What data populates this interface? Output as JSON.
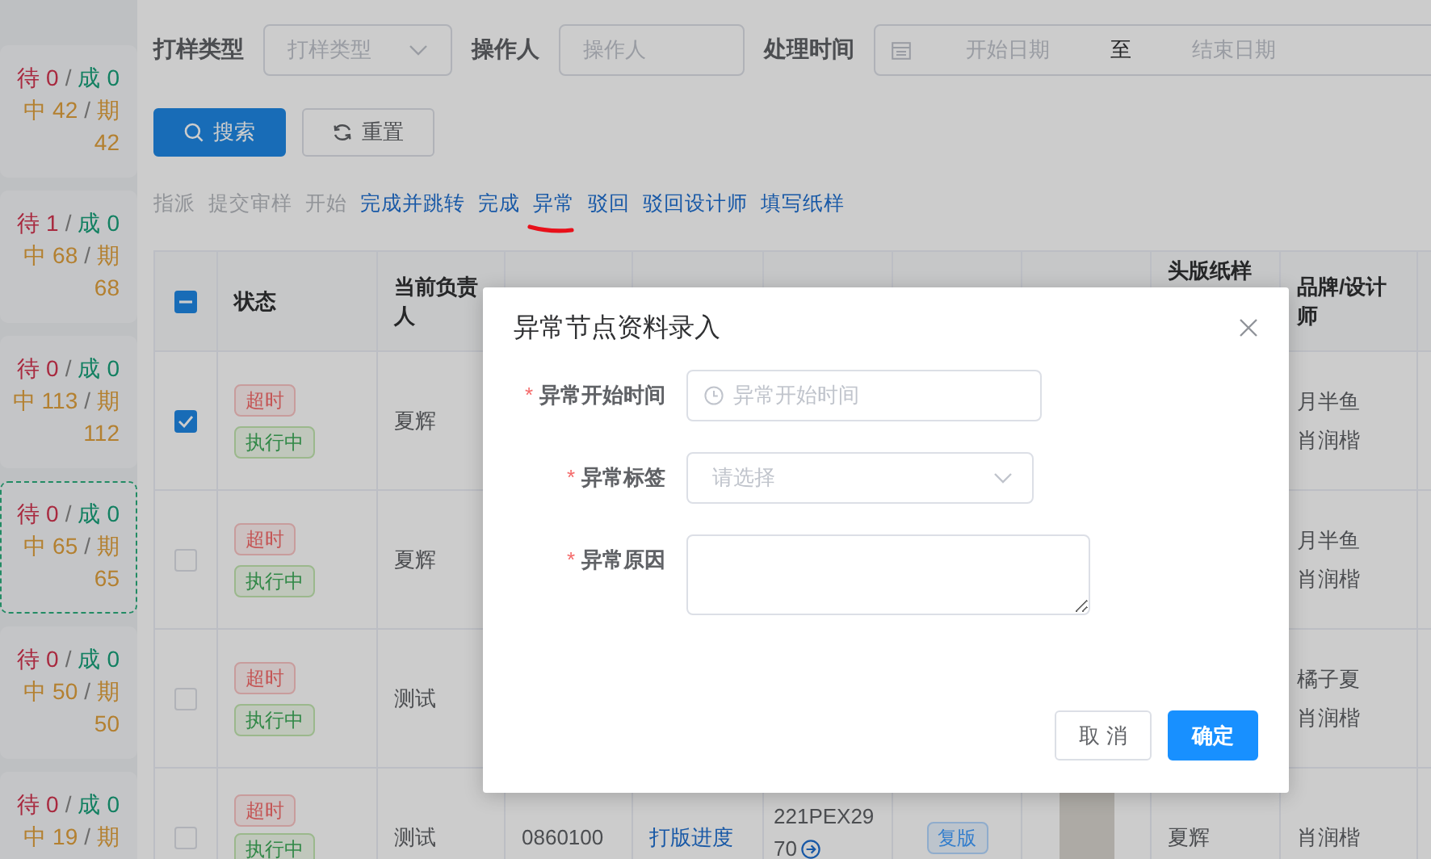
{
  "side_panel": {
    "separator": "/",
    "cards": [
      {
        "selected": false,
        "stats": [
          {
            "kind": "pending",
            "label": "待",
            "value": "0"
          },
          {
            "kind": "done",
            "label": "成",
            "value": "0"
          },
          {
            "kind": "active",
            "label": "中",
            "value": "42"
          },
          {
            "kind": "due",
            "label": "期",
            "value": "42"
          }
        ]
      },
      {
        "selected": false,
        "stats": [
          {
            "kind": "pending",
            "label": "待",
            "value": "1"
          },
          {
            "kind": "done",
            "label": "成",
            "value": "0"
          },
          {
            "kind": "active",
            "label": "中",
            "value": "68"
          },
          {
            "kind": "due",
            "label": "期",
            "value": "68"
          }
        ]
      },
      {
        "selected": false,
        "stats": [
          {
            "kind": "pending",
            "label": "待",
            "value": "0"
          },
          {
            "kind": "done",
            "label": "成",
            "value": "0"
          },
          {
            "kind": "active",
            "label": "中",
            "value": "113"
          },
          {
            "kind": "due",
            "label": "期",
            "value": "112"
          }
        ]
      },
      {
        "selected": true,
        "stats": [
          {
            "kind": "pending",
            "label": "待",
            "value": "0"
          },
          {
            "kind": "done",
            "label": "成",
            "value": "0"
          },
          {
            "kind": "active",
            "label": "中",
            "value": "65"
          },
          {
            "kind": "due",
            "label": "期",
            "value": "65"
          }
        ]
      },
      {
        "selected": false,
        "stats": [
          {
            "kind": "pending",
            "label": "待",
            "value": "0"
          },
          {
            "kind": "done",
            "label": "成",
            "value": "0"
          },
          {
            "kind": "active",
            "label": "中",
            "value": "50"
          },
          {
            "kind": "due",
            "label": "期",
            "value": "50"
          }
        ]
      },
      {
        "selected": false,
        "stats": [
          {
            "kind": "pending",
            "label": "待",
            "value": "0"
          },
          {
            "kind": "done",
            "label": "成",
            "value": "0"
          },
          {
            "kind": "active",
            "label": "中",
            "value": "19"
          },
          {
            "kind": "due",
            "label": "期"
          }
        ]
      }
    ]
  },
  "filters": [
    {
      "kind": "select",
      "label": "打样类型",
      "placeholder": "打样类型"
    },
    {
      "kind": "input",
      "label": "操作人",
      "placeholder": "操作人"
    },
    {
      "kind": "daterange",
      "label": "处理时间",
      "start_placeholder": "开始日期",
      "separator": "至",
      "end_placeholder": "结束日期"
    }
  ],
  "buttons": [
    {
      "kind": "primary",
      "label": "搜索"
    },
    {
      "kind": "reset",
      "label": "重置"
    }
  ],
  "actions": [
    {
      "label": "指派",
      "disabled": true,
      "annotated": false
    },
    {
      "label": "提交审样",
      "disabled": true,
      "annotated": false
    },
    {
      "label": "开始",
      "disabled": true,
      "annotated": false
    },
    {
      "label": "完成并跳转",
      "disabled": false,
      "annotated": false
    },
    {
      "label": "完成",
      "disabled": false,
      "annotated": false
    },
    {
      "label": "异常",
      "disabled": false,
      "annotated": true
    },
    {
      "label": "驳回",
      "disabled": false,
      "annotated": false
    },
    {
      "label": "驳回设计师",
      "disabled": false,
      "annotated": false
    },
    {
      "label": "填写纸样",
      "disabled": false,
      "annotated": false
    }
  ],
  "table": {
    "header_checkbox": {
      "indeterminate": true
    },
    "columns": [
      {
        "kind": "label",
        "label": "状态"
      },
      {
        "kind": "label",
        "label": "当前负责人"
      },
      {
        "kind": "covered"
      },
      {
        "kind": "covered"
      },
      {
        "kind": "covered"
      },
      {
        "kind": "covered"
      },
      {
        "kind": "covered"
      },
      {
        "kind": "clipped",
        "label": "头版纸样"
      },
      {
        "kind": "label",
        "label": "品牌/设计师"
      },
      {
        "kind": "covered"
      }
    ],
    "rows": [
      {
        "selected": true,
        "tags": [
          {
            "kind": "danger",
            "text": "超时"
          },
          {
            "kind": "success",
            "text": "执行中"
          }
        ],
        "owner": "夏辉",
        "cells": [],
        "brand_designer": [
          "月半鱼",
          "肖润楷"
        ]
      },
      {
        "selected": false,
        "tags": [
          {
            "kind": "danger",
            "text": "超时"
          },
          {
            "kind": "success",
            "text": "执行中"
          }
        ],
        "owner": "夏辉",
        "cells": [],
        "brand_designer": [
          "月半鱼",
          "肖润楷"
        ]
      },
      {
        "selected": false,
        "tags": [
          {
            "kind": "danger",
            "text": "超时"
          },
          {
            "kind": "success",
            "text": "执行中"
          }
        ],
        "owner": "测试",
        "cells": [],
        "brand_designer": [
          "橘子夏",
          "肖润楷"
        ]
      },
      {
        "selected": false,
        "tags": [
          {
            "kind": "danger",
            "text": "超时"
          },
          {
            "kind": "success",
            "text": "执行中"
          }
        ],
        "owner": "测试",
        "cells": [
          {
            "kind": "text",
            "lines": [
              "0860100"
            ]
          },
          {
            "kind": "link",
            "text": "打版进度"
          },
          {
            "kind": "code",
            "lines": [
              "221PEX29",
              "70"
            ]
          },
          {
            "kind": "tag",
            "text": "复版"
          },
          {
            "kind": "photo"
          },
          {
            "kind": "text",
            "lines": [
              "夏辉"
            ]
          }
        ],
        "brand_designer": [
          "肖润楷"
        ]
      }
    ]
  },
  "dialog": {
    "title": "异常节点资料录入",
    "required_mark": "*",
    "fields": [
      {
        "kind": "time",
        "label": "异常开始时间",
        "required": true,
        "placeholder": "异常开始时间"
      },
      {
        "kind": "select",
        "label": "异常标签",
        "required": true,
        "placeholder": "请选择"
      },
      {
        "kind": "textarea",
        "label": "异常原因",
        "required": true
      }
    ],
    "buttons": [
      {
        "kind": "default",
        "label": "取 消"
      },
      {
        "kind": "primary",
        "label": "确定"
      }
    ]
  }
}
